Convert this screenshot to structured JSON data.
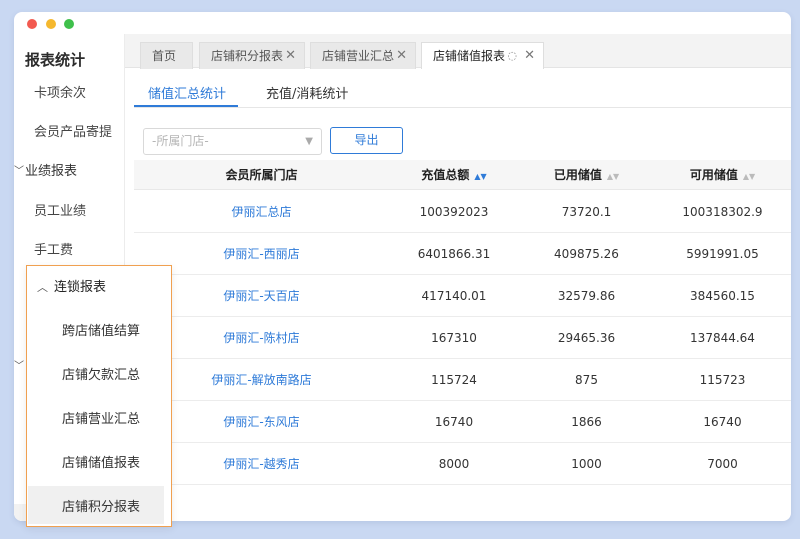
{
  "sidebar": {
    "title": "报表统计",
    "items": [
      "卡项余次",
      "会员产品寄提"
    ],
    "group_performance": "业绩报表",
    "items2": [
      "员工业绩",
      "手工费"
    ]
  },
  "tabs": [
    {
      "label": "首页"
    },
    {
      "label": "店铺积分报表"
    },
    {
      "label": "店铺营业汇总"
    },
    {
      "label": "店铺储值报表"
    }
  ],
  "subtabs": [
    "储值汇总统计",
    "充值/消耗统计"
  ],
  "filter": {
    "store_placeholder": "-所属门店-",
    "export_label": "导出"
  },
  "table": {
    "headers": [
      "会员所属门店",
      "充值总额",
      "已用储值",
      "可用储值"
    ],
    "rows": [
      [
        "伊丽汇总店",
        "100392023",
        "73720.1",
        "100318302.9"
      ],
      [
        "伊丽汇-西丽店",
        "6401866.31",
        "409875.26",
        "5991991.05"
      ],
      [
        "伊丽汇-天百店",
        "417140.01",
        "32579.86",
        "384560.15"
      ],
      [
        "伊丽汇-陈村店",
        "167310",
        "29465.36",
        "137844.64"
      ],
      [
        "伊丽汇-解放南路店",
        "115724",
        "875",
        "115723"
      ],
      [
        "伊丽汇-东风店",
        "16740",
        "1866",
        "16740"
      ],
      [
        "伊丽汇-越秀店",
        "8000",
        "1000",
        "7000"
      ]
    ]
  },
  "popup": {
    "group_label": "连锁报表",
    "items": [
      "跨店储值结算",
      "店铺欠款汇总",
      "店铺营业汇总",
      "店铺储值报表",
      "店铺积分报表"
    ]
  },
  "colors": {
    "accent": "#2f7bd8",
    "highlight_border": "#f0a050",
    "background": "#c9d8f2"
  }
}
